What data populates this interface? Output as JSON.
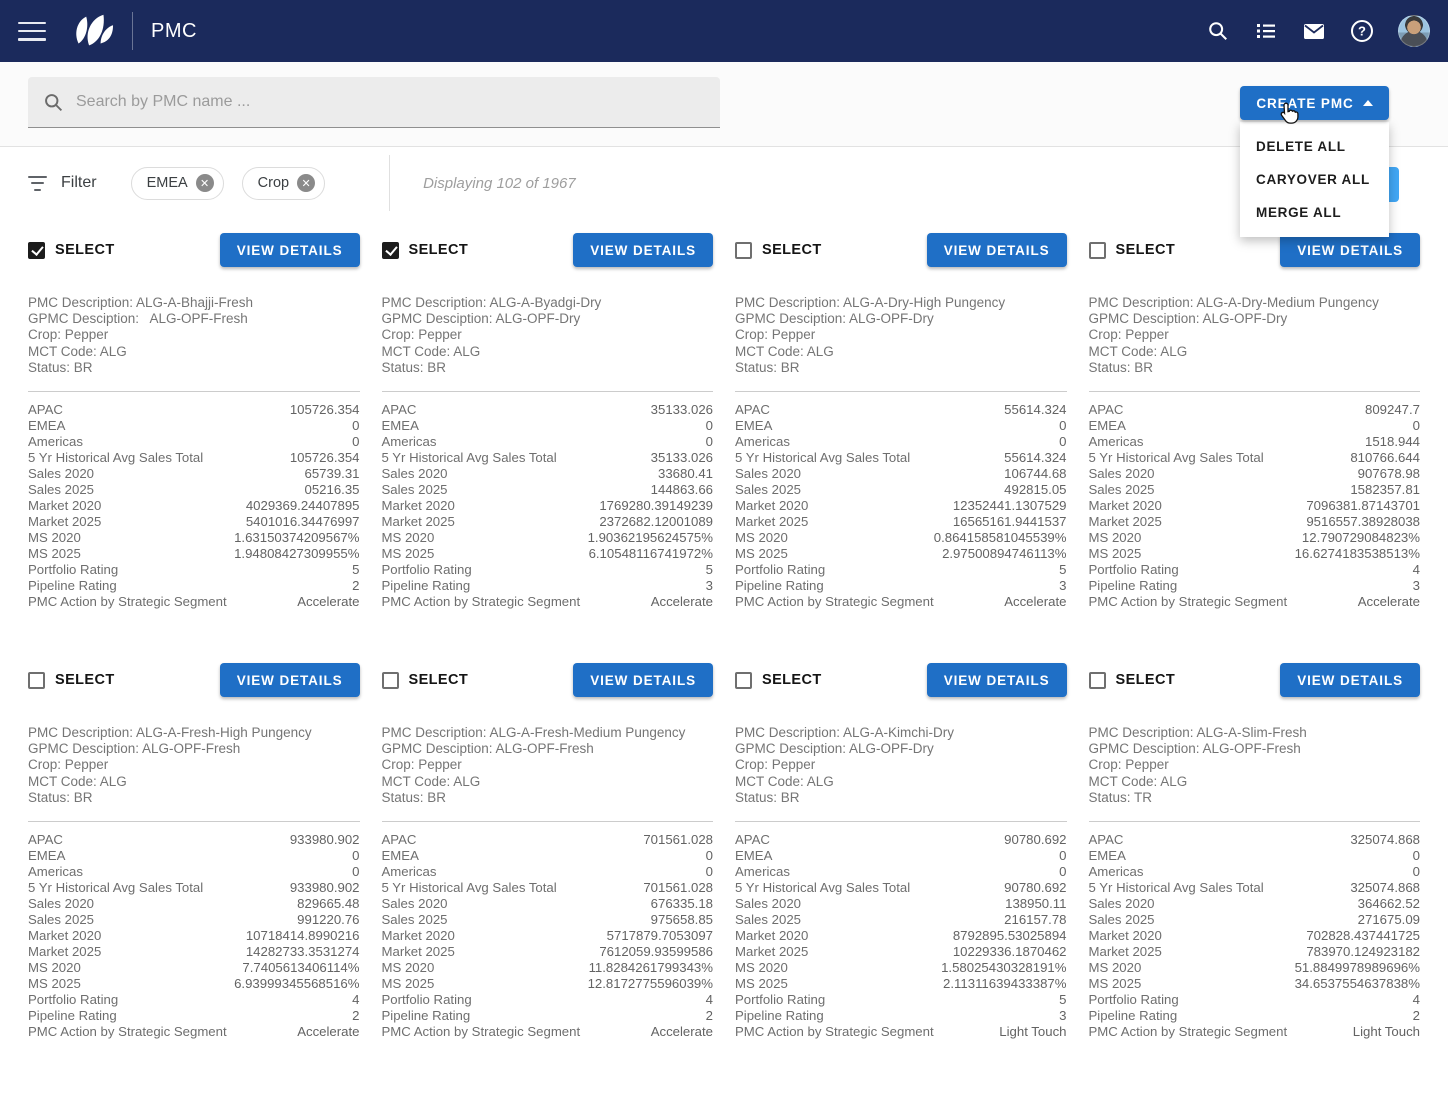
{
  "navbar": {
    "title": "PMC"
  },
  "search": {
    "placeholder": "Search by PMC name ..."
  },
  "create_menu": {
    "button_label": "CREATE PMC",
    "items": [
      "DELETE ALL",
      "CARYOVER ALL",
      "MERGE ALL"
    ]
  },
  "filter_bar": {
    "label": "Filter",
    "chips": [
      {
        "label": "EMEA"
      },
      {
        "label": "Crop"
      }
    ],
    "displaying_text": "Displaying 102 of 1967"
  },
  "card_common": {
    "select_label": "SELECT",
    "view_details_label": "VIEW DETAILS",
    "metric_labels": [
      "APAC",
      "EMEA",
      "Americas",
      "5 Yr Historical Avg Sales Total",
      "Sales 2020",
      "Sales 2025",
      "Market 2020",
      "Market 2025",
      "MS 2020",
      "MS 2025",
      "Portfolio Rating",
      "Pipeline Rating",
      "PMC Action by Strategic Segment"
    ]
  },
  "cards": [
    {
      "selected": true,
      "info": [
        "PMC Description: ALG-A-Bhajji-Fresh",
        "GPMC Desciption:   ALG-OPF-Fresh",
        "Crop: Pepper",
        "MCT Code: ALG",
        "Status: BR"
      ],
      "values": [
        "105726.354",
        "0",
        "0",
        "105726.354",
        "65739.31",
        "05216.35",
        "4029369.24407895",
        "5401016.34476997",
        "1.63150374209567%",
        "1.94808427309955%",
        "5",
        "2",
        "Accelerate"
      ]
    },
    {
      "selected": true,
      "info": [
        "PMC Description: ALG-A-Byadgi-Dry",
        "GPMC Desciption: ALG-OPF-Dry",
        "Crop: Pepper",
        "MCT Code: ALG",
        "Status: BR"
      ],
      "values": [
        "35133.026",
        "0",
        "0",
        "35133.026",
        "33680.41",
        "144863.66",
        "1769280.39149239",
        "2372682.12001089",
        "1.90362195624575%",
        "6.10548116741972%",
        "5",
        "3",
        "Accelerate"
      ]
    },
    {
      "selected": false,
      "info": [
        "PMC Description: ALG-A-Dry-High Pungency",
        "GPMC Desciption: ALG-OPF-Dry",
        "Crop: Pepper",
        "MCT Code: ALG",
        "Status: BR"
      ],
      "values": [
        "55614.324",
        "0",
        "0",
        "55614.324",
        "106744.68",
        "492815.05",
        "12352441.1307529",
        "16565161.9441537",
        "0.864158581045539%",
        "2.97500894746113%",
        "5",
        "3",
        "Accelerate"
      ]
    },
    {
      "selected": false,
      "info": [
        "PMC Description: ALG-A-Dry-Medium Pungency",
        "GPMC Desciption: ALG-OPF-Dry",
        "Crop: Pepper",
        "MCT Code: ALG",
        "Status: BR"
      ],
      "values": [
        "809247.7",
        "0",
        "1518.944",
        "810766.644",
        "907678.98",
        "1582357.81",
        "7096381.87143701",
        "9516557.38928038",
        "12.790729084823%",
        "16.6274183538513%",
        "4",
        "3",
        "Accelerate"
      ]
    },
    {
      "selected": false,
      "info": [
        "PMC Description: ALG-A-Fresh-High Pungency",
        "GPMC Desciption: ALG-OPF-Fresh",
        "Crop: Pepper",
        "MCT Code: ALG",
        "Status: BR"
      ],
      "values": [
        "933980.902",
        "0",
        "0",
        "933980.902",
        "829665.48",
        "991220.76",
        "10718414.8990216",
        "14282733.3531274",
        "7.7405613406114%",
        "6.93999345568516%",
        "4",
        "2",
        "Accelerate"
      ]
    },
    {
      "selected": false,
      "info": [
        "PMC Description: ALG-A-Fresh-Medium Pungency",
        "GPMC Desciption: ALG-OPF-Fresh",
        "Crop: Pepper",
        "MCT Code: ALG",
        "Status: BR"
      ],
      "values": [
        "701561.028",
        "0",
        "0",
        "701561.028",
        "676335.18",
        "975658.85",
        "5717879.7053097",
        "7612059.93599586",
        "11.8284261799343%",
        "12.8172775596039%",
        "4",
        "2",
        "Accelerate"
      ]
    },
    {
      "selected": false,
      "info": [
        "PMC Description: ALG-A-Kimchi-Dry",
        "GPMC Desciption: ALG-OPF-Dry",
        "Crop: Pepper",
        "MCT Code: ALG",
        "Status: BR"
      ],
      "values": [
        "90780.692",
        "0",
        "0",
        "90780.692",
        "138950.11",
        "216157.78",
        "8792895.53025894",
        "10229336.1870462",
        "1.58025430328191%",
        "2.11311639433387%",
        "5",
        "3",
        "Light Touch"
      ]
    },
    {
      "selected": false,
      "info": [
        "PMC Description: ALG-A-Slim-Fresh",
        "GPMC Desciption: ALG-OPF-Fresh",
        "Crop: Pepper",
        "MCT Code: ALG",
        "Status: TR"
      ],
      "values": [
        "325074.868",
        "0",
        "0",
        "325074.868",
        "364662.52",
        "271675.09",
        "702828.437441725",
        "783970.124923182",
        "51.8849978989696%",
        "34.6537554637838%",
        "4",
        "2",
        "Light Touch"
      ]
    }
  ],
  "colors": {
    "navbar_bg": "#1b2a5c",
    "primary_button": "#1f6fc6",
    "hidden_action_button": "#41a7f5"
  }
}
